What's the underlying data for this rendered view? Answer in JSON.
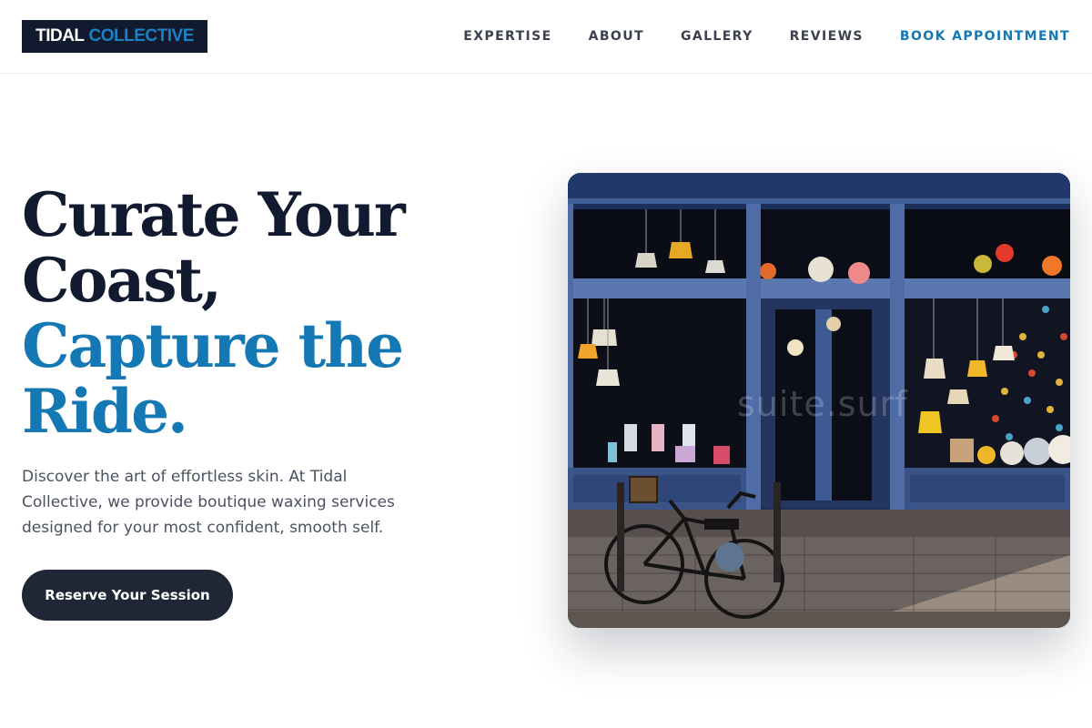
{
  "brand": {
    "name_primary": "TIDAL",
    "name_accent": "COLLECTIVE"
  },
  "nav": {
    "items": [
      {
        "label": "EXPERTISE"
      },
      {
        "label": "ABOUT"
      },
      {
        "label": "GALLERY"
      },
      {
        "label": "REVIEWS"
      }
    ],
    "cta_label": "BOOK APPOINTMENT"
  },
  "hero": {
    "headline_line1": "Curate Your",
    "headline_line2": "Coast,",
    "headline_line3": "Capture the",
    "headline_line4": "Ride.",
    "subtext": "Discover the art of effortless skin. At Tidal Collective, we provide boutique waxing services designed for your most confident, smooth self.",
    "button_label": "Reserve Your Session"
  },
  "image": {
    "watermark": "suite.surf"
  },
  "colors": {
    "navy": "#111a2e",
    "accent_blue": "#1478b4",
    "button_bg": "#1f2737",
    "body_text": "#4b5261"
  }
}
